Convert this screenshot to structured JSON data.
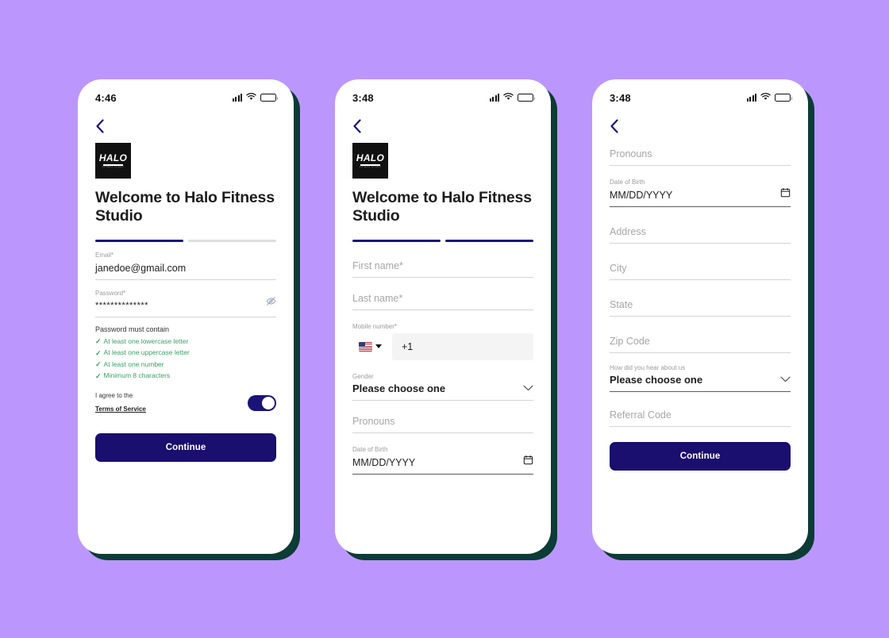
{
  "background_color": "#bb97fd",
  "colors": {
    "navy": "#1a1478",
    "cta_navy": "#1a0e6e",
    "teal_shadow": "#0d3b35",
    "green_check": "#39a06a",
    "gray_track": "#dedede"
  },
  "brand": {
    "logo_word": "HALO",
    "logo_sub": "FITNESS STUDIO"
  },
  "screens": [
    {
      "id": "screen-account",
      "status_bar": {
        "time": "4:46",
        "signal": "signal-icon",
        "wifi": "wifi-icon",
        "battery": "battery-icon"
      },
      "back_label": "Back",
      "heading": "Welcome to Halo Fitness Studio",
      "progress": {
        "total": 2,
        "filled": 1
      },
      "fields": [
        {
          "name": "email",
          "label": "Email*",
          "value": "janedoe@gmail.com",
          "placeholder": ""
        },
        {
          "name": "password",
          "label": "Password*",
          "value": "**************",
          "placeholder": "",
          "icon": "eye-off-icon"
        }
      ],
      "password_rules": {
        "title": "Password must contain",
        "items": [
          "At least one lowercase letter",
          "At least one uppercase letter",
          "At least one number",
          "Minimum 8 characters"
        ]
      },
      "terms": {
        "text": "I agree to the",
        "link": "Terms of Service",
        "toggle_on": true
      },
      "cta": "Continue"
    },
    {
      "id": "screen-personal",
      "status_bar": {
        "time": "3:48",
        "signal": "signal-icon",
        "wifi": "wifi-icon",
        "battery": "battery-icon"
      },
      "back_label": "Back",
      "heading": "Welcome to Halo Fitness Studio",
      "progress": {
        "total": 2,
        "filled": 2
      },
      "first_name": {
        "label": "",
        "placeholder": "First name*"
      },
      "last_name": {
        "label": "",
        "placeholder": "Last name*"
      },
      "mobile": {
        "label": "Mobile number*",
        "country": "us-flag-icon",
        "dial_code": "+1"
      },
      "gender": {
        "label": "Gender",
        "value": "Please choose one"
      },
      "pronouns": {
        "label": "",
        "placeholder": "Pronouns"
      },
      "dob": {
        "label": "Date of Birth",
        "placeholder": "MM/DD/YYYY",
        "icon": "calendar-icon"
      }
    },
    {
      "id": "screen-address",
      "status_bar": {
        "time": "3:48",
        "signal": "signal-icon",
        "wifi": "wifi-icon",
        "battery": "battery-icon"
      },
      "back_label": "Back",
      "pronouns": {
        "label": "",
        "placeholder": "Pronouns"
      },
      "dob": {
        "label": "Date of Birth",
        "placeholder": "MM/DD/YYYY",
        "icon": "calendar-icon"
      },
      "address": {
        "label": "",
        "placeholder": "Address"
      },
      "city": {
        "label": "",
        "placeholder": "City"
      },
      "state": {
        "label": "",
        "placeholder": "State"
      },
      "zip": {
        "label": "",
        "placeholder": "Zip Code"
      },
      "hear_about": {
        "label": "How did you hear about us",
        "value": "Please choose one"
      },
      "referral": {
        "label": "",
        "placeholder": "Referral Code"
      },
      "cta": "Continue"
    }
  ]
}
